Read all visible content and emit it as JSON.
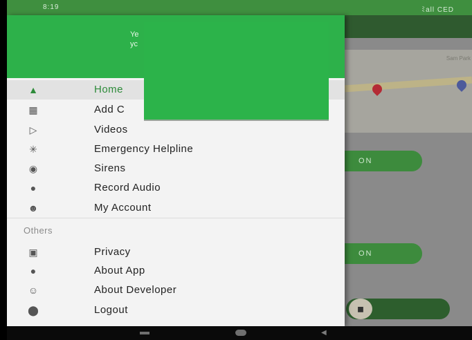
{
  "status_bar": {
    "time": "8:19",
    "indicators": "ﾐall CED"
  },
  "background_app": {
    "map_label": "Sam Park",
    "button_1": "ON",
    "button_2": "ON",
    "button_3_icon": "speaker-icon"
  },
  "drawer": {
    "header_line_1": "Ye",
    "header_line_2": "yc",
    "menu": [
      {
        "label": "Home",
        "icon": "home-icon",
        "selected": true
      },
      {
        "label": "Add C",
        "icon": "contacts-icon",
        "selected": false
      },
      {
        "label": "Videos",
        "icon": "video-icon",
        "selected": false
      },
      {
        "label": "Emergency Helpline",
        "icon": "helpline-icon",
        "selected": false
      },
      {
        "label": "Sirens",
        "icon": "siren-icon",
        "selected": false
      },
      {
        "label": "Record Audio",
        "icon": "microphone-icon",
        "selected": false
      },
      {
        "label": "My Account",
        "icon": "account-icon",
        "selected": false
      }
    ],
    "others_title": "Others",
    "others": [
      {
        "label": "Privacy",
        "icon": "lock-icon"
      },
      {
        "label": "About App",
        "icon": "info-icon"
      },
      {
        "label": "About Developer",
        "icon": "developer-icon"
      },
      {
        "label": "Logout",
        "icon": "logout-icon"
      }
    ]
  },
  "colors": {
    "drawer_header": "#2db14a",
    "status_bar": "#3f8f3f",
    "accent": "#2e8b3a"
  }
}
